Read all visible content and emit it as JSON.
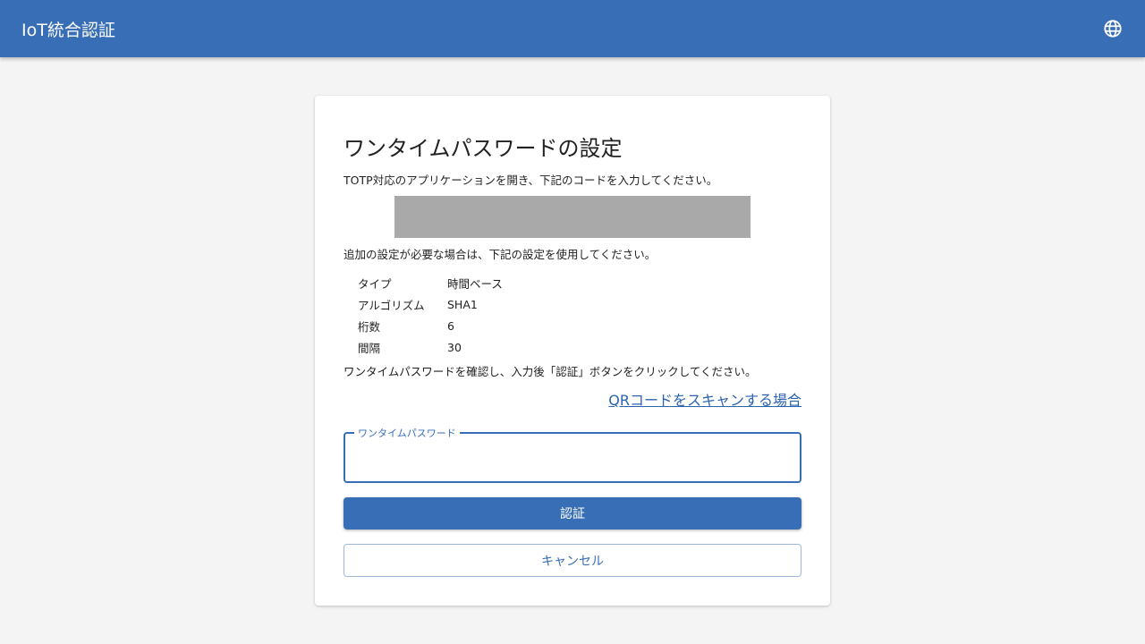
{
  "header": {
    "title": "IoT統合認証",
    "language_icon": "globe-icon"
  },
  "card": {
    "title": "ワンタイムパスワードの設定",
    "instruction_open_app": "TOTP対応のアプリケーションを開き、下記のコードを入力してください。",
    "instruction_additional": "追加の設定が必要な場合は、下記の設定を使用してください。",
    "settings": [
      {
        "key": "タイプ",
        "value": "時間ベース"
      },
      {
        "key": "アルゴリズム",
        "value": "SHA1"
      },
      {
        "key": "桁数",
        "value": "6"
      },
      {
        "key": "間隔",
        "value": "30"
      }
    ],
    "instruction_confirm": "ワンタイムパスワードを確認し、入力後「認証」ボタンをクリックしてください。",
    "qr_link": "QRコードをスキャンする場合",
    "otp_label": "ワンタイムパスワード",
    "otp_value": "",
    "auth_button": "認証",
    "cancel_button": "キャンセル"
  },
  "colors": {
    "primary": "#386eb5",
    "link": "#2c64b0",
    "background": "#f4f4f4",
    "secret_mask": "#a9a9a9"
  }
}
